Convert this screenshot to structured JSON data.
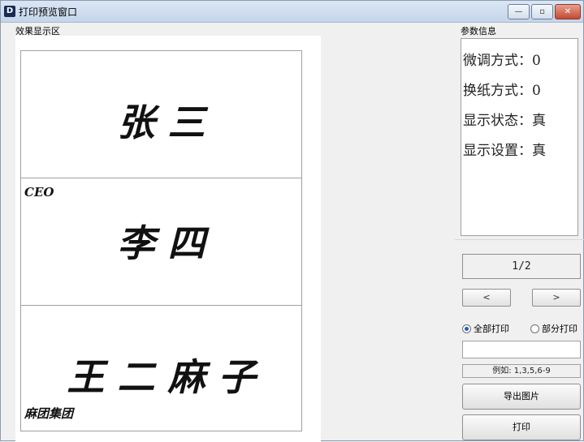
{
  "window": {
    "title": "打印预览窗口",
    "icon": "app-logo-icon",
    "controls": {
      "minimize": "—",
      "maximize": "▫",
      "close": "✕"
    }
  },
  "preview": {
    "label": "效果显示区",
    "cards": [
      {
        "name": "张  三",
        "subtitle": "",
        "footer": ""
      },
      {
        "name": "李 四",
        "subtitle": "CEO",
        "footer": ""
      },
      {
        "name": "王 二 麻 子",
        "subtitle": "",
        "footer": "麻团集团"
      }
    ]
  },
  "params": {
    "label": "参数信息",
    "lines": [
      "微调方式：0",
      "换纸方式：0",
      "显示状态：真",
      "显示设置：真"
    ]
  },
  "pager": {
    "current": "1/2",
    "prev_label": "<",
    "next_label": ">"
  },
  "print_mode": {
    "all_label": "全部打印",
    "partial_label": "部分打印",
    "selected": "all"
  },
  "range_input": {
    "value": "",
    "hint": "例如: 1,3,5,6-9"
  },
  "buttons": {
    "export": "导出图片",
    "print": "打印"
  }
}
